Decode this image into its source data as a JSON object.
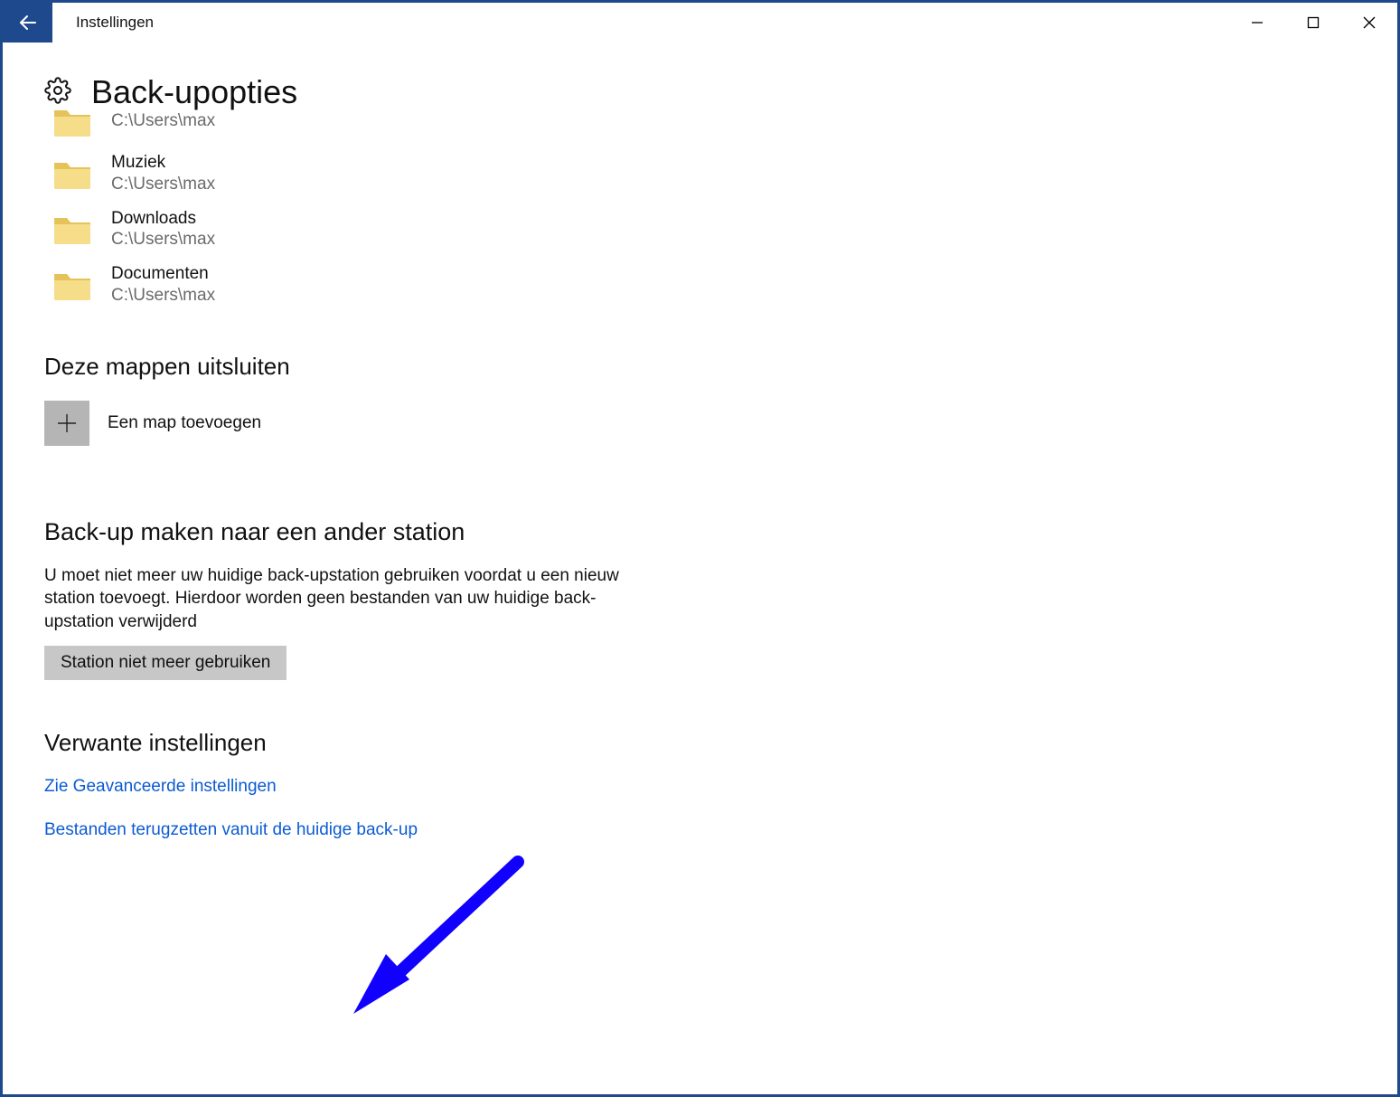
{
  "window": {
    "title": "Instellingen"
  },
  "page": {
    "title": "Back-upopties"
  },
  "folders": [
    {
      "name": "",
      "path": "C:\\Users\\max"
    },
    {
      "name": "Muziek",
      "path": "C:\\Users\\max"
    },
    {
      "name": "Downloads",
      "path": "C:\\Users\\max"
    },
    {
      "name": "Documenten",
      "path": "C:\\Users\\max"
    }
  ],
  "exclude_section": {
    "heading": "Deze mappen uitsluiten",
    "add_label": "Een map toevoegen"
  },
  "drive_section": {
    "heading": "Back-up maken naar een ander station",
    "description": "U moet niet meer uw huidige back-upstation gebruiken voordat u een nieuw station toevoegt. Hierdoor worden geen bestanden van uw huidige back-upstation verwijderd",
    "button": "Station niet meer gebruiken"
  },
  "related_section": {
    "heading": "Verwante instellingen",
    "link1": "Zie Geavanceerde instellingen",
    "link2": "Bestanden terugzetten vanuit de huidige back-up"
  }
}
